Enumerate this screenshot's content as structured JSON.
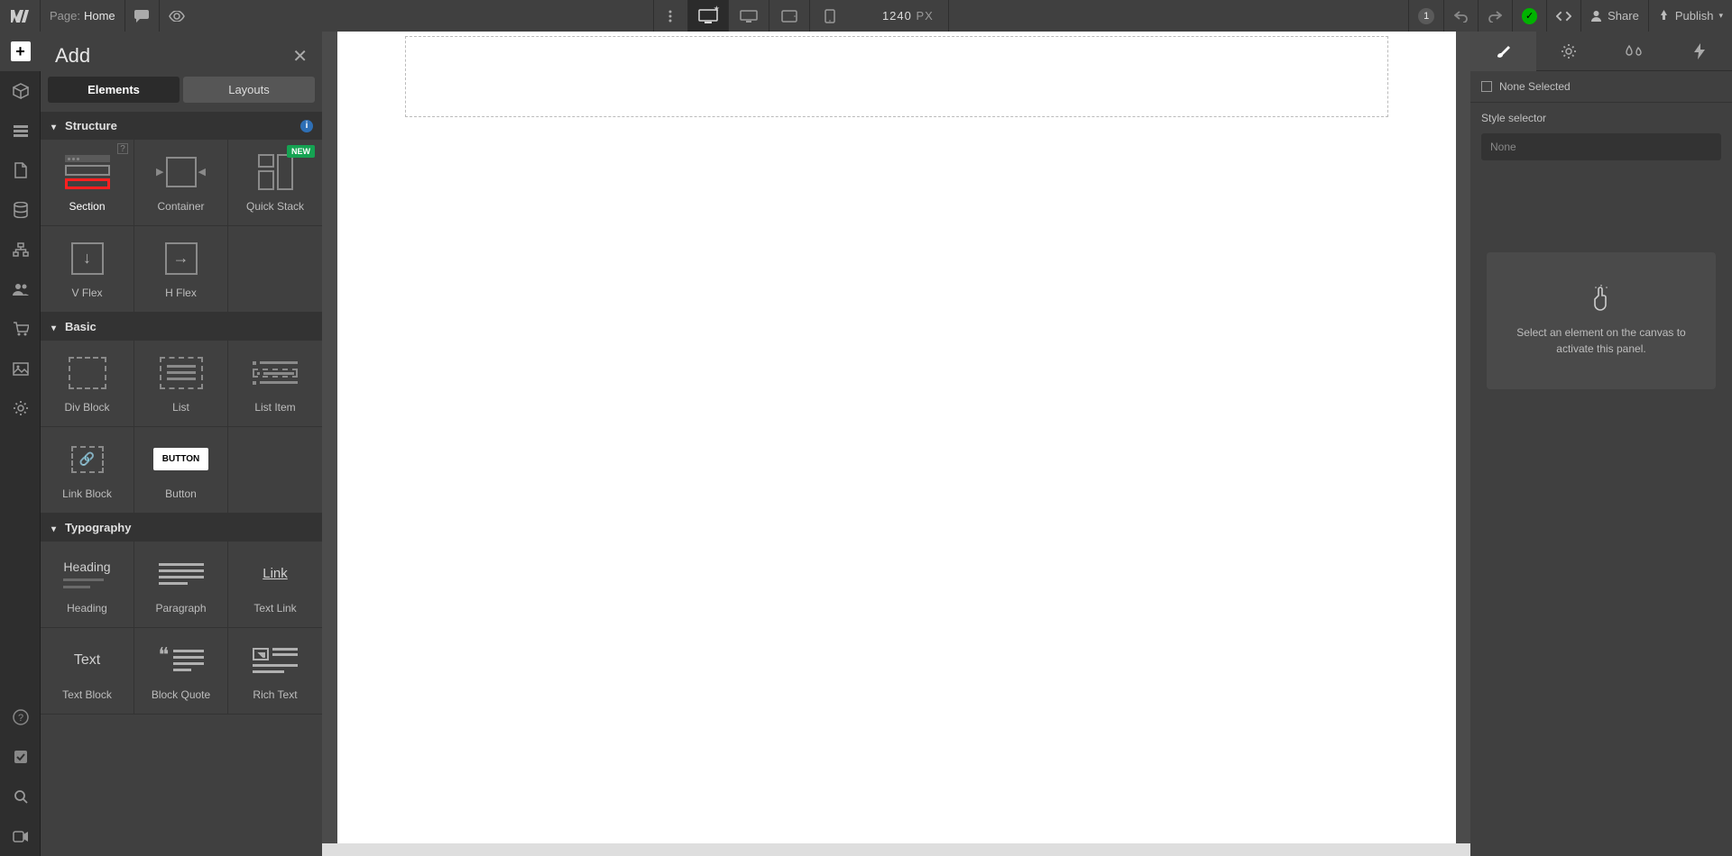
{
  "topbar": {
    "page_label": "Page:",
    "page_name": "Home",
    "canvas_width": "1240",
    "canvas_unit": "PX",
    "queue_count": "1",
    "share": "Share",
    "publish": "Publish"
  },
  "addpanel": {
    "title": "Add",
    "tabs": {
      "elements": "Elements",
      "layouts": "Layouts"
    },
    "sections": {
      "structure": "Structure",
      "basic": "Basic",
      "typography": "Typography"
    },
    "badges": {
      "new": "NEW"
    },
    "els": {
      "section": "Section",
      "container": "Container",
      "quick_stack": "Quick Stack",
      "v_flex": "V Flex",
      "h_flex": "H Flex",
      "div_block": "Div Block",
      "list": "List",
      "list_item": "List Item",
      "link_block": "Link Block",
      "button": "Button",
      "button_icon_text": "BUTTON",
      "heading": "Heading",
      "heading_icon_text": "Heading",
      "paragraph": "Paragraph",
      "text_link": "Text Link",
      "text_link_icon_text": "Link",
      "text_block": "Text Block",
      "text_block_icon_text": "Text",
      "block_quote": "Block Quote",
      "rich_text": "Rich Text"
    }
  },
  "rightpanel": {
    "none_selected": "None Selected",
    "style_selector": "Style selector",
    "none": "None",
    "empty": "Select an element on the canvas to activate this panel."
  }
}
